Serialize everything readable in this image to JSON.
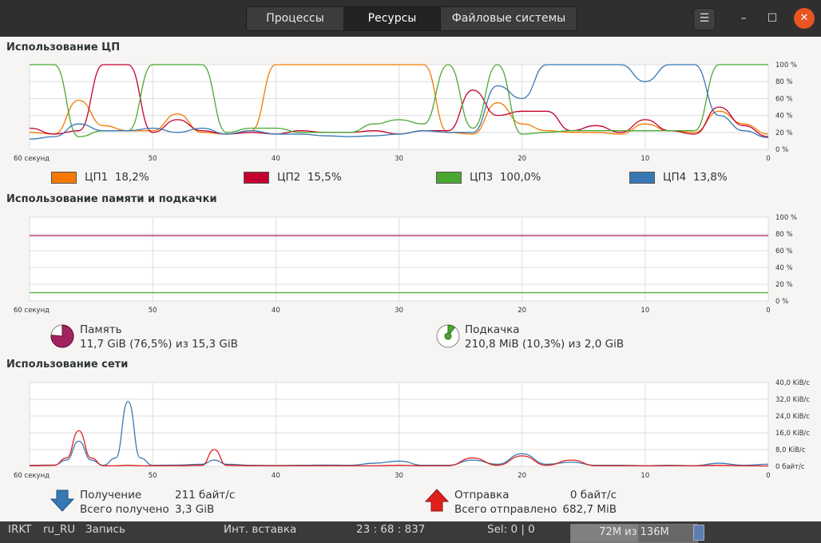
{
  "tabs": [
    {
      "label": "Процессы",
      "active": false
    },
    {
      "label": "Ресурсы",
      "active": true
    },
    {
      "label": "Файловые системы",
      "active": false
    }
  ],
  "window_buttons": {
    "menu_icon": "hamburger-menu-icon",
    "minimize_icon": "minimize-icon",
    "maximize_icon": "maximize-icon",
    "close_icon": "close-icon"
  },
  "sections": {
    "cpu_title": "Использование ЦП",
    "mem_title": "Использование памяти и подкачки",
    "net_title": "Использование сети"
  },
  "x_axis_labels": [
    "60 секунд",
    "50",
    "40",
    "30",
    "20",
    "10",
    "0"
  ],
  "cpu": {
    "legend": [
      {
        "label": "ЦП1",
        "value": "18,2%",
        "color": "#f57900"
      },
      {
        "label": "ЦП2",
        "value": "15,5%",
        "color": "#c4002f"
      },
      {
        "label": "ЦП3",
        "value": "100,0%",
        "color": "#4aa832"
      },
      {
        "label": "ЦП4",
        "value": "13,8%",
        "color": "#3778b4"
      }
    ]
  },
  "memory": {
    "label": "Память",
    "detail": "11,7 GiB (76,5%) из 15,3 GiB",
    "percent": 76.5,
    "color": "#a3225f",
    "swap_label": "Подкачка",
    "swap_detail": "210,8 MiB (10,3%) из 2,0 GiB",
    "swap_percent": 10.3,
    "swap_color": "#4aa832",
    "icon": "memory-pie-icon",
    "swap_icon": "swap-pie-icon"
  },
  "network": {
    "recv_label": "Получение",
    "recv_rate": "211 байт/с",
    "recv_total_label": "Всего получено",
    "recv_total": "3,3 GiB",
    "recv_color": "#3778b4",
    "recv_icon": "download-arrow-icon",
    "send_label": "Отправка",
    "send_rate": "0 байт/с",
    "send_total_label": "Всего отправлено",
    "send_total": "682,7 MiB",
    "send_color": "#e0201a",
    "send_icon": "upload-arrow-icon"
  },
  "status_bar": {
    "items": [
      "IRKT",
      "ru_RU",
      "Запись",
      "Инт. вставка",
      "23 : 68 : 837",
      "Sel: 0 | 0"
    ],
    "memory_text": "72M из 136M",
    "memory_fraction": 0.53,
    "trash_icon": "trash-icon"
  },
  "chart_data": [
    {
      "type": "line",
      "title": "Использование ЦП",
      "x": [
        60,
        58,
        56,
        54,
        52,
        50,
        48,
        46,
        44,
        42,
        40,
        38,
        36,
        34,
        32,
        30,
        28,
        26,
        24,
        22,
        20,
        18,
        16,
        14,
        12,
        10,
        8,
        6,
        4,
        2,
        0
      ],
      "xlabel_ticks": [
        "60 секунд",
        "50",
        "40",
        "30",
        "20",
        "10",
        "0"
      ],
      "ylim": [
        0,
        100
      ],
      "y_ticks": [
        "100 %",
        "80 %",
        "60 %",
        "40 %",
        "20 %",
        "0 %"
      ],
      "series": [
        {
          "name": "ЦП1",
          "values": [
            20,
            18,
            58,
            28,
            22,
            22,
            42,
            20,
            18,
            22,
            100,
            100,
            100,
            100,
            100,
            100,
            100,
            20,
            18,
            55,
            30,
            22,
            20,
            20,
            18,
            30,
            22,
            20,
            45,
            30,
            18
          ]
        },
        {
          "name": "ЦП2",
          "values": [
            25,
            18,
            22,
            100,
            100,
            20,
            35,
            22,
            18,
            20,
            18,
            22,
            20,
            20,
            22,
            18,
            22,
            22,
            70,
            40,
            45,
            45,
            22,
            28,
            20,
            35,
            22,
            18,
            50,
            28,
            15
          ]
        },
        {
          "name": "ЦП3",
          "values": [
            100,
            100,
            15,
            22,
            22,
            100,
            100,
            100,
            20,
            25,
            25,
            20,
            20,
            20,
            30,
            35,
            30,
            100,
            25,
            100,
            18,
            20,
            22,
            22,
            22,
            22,
            22,
            22,
            100,
            100,
            100
          ]
        },
        {
          "name": "ЦП4",
          "values": [
            12,
            15,
            30,
            22,
            22,
            25,
            20,
            25,
            18,
            22,
            18,
            18,
            16,
            15,
            16,
            18,
            22,
            20,
            20,
            75,
            60,
            100,
            100,
            100,
            100,
            80,
            100,
            100,
            40,
            22,
            14
          ]
        }
      ]
    },
    {
      "type": "line",
      "title": "Использование памяти и подкачки",
      "x": [
        60,
        50,
        40,
        30,
        20,
        10,
        0
      ],
      "ylim": [
        0,
        100
      ],
      "y_ticks": [
        "100 %",
        "80 %",
        "60 %",
        "40 %",
        "20 %",
        "0 %"
      ],
      "series": [
        {
          "name": "Память",
          "values": [
            78,
            78,
            78,
            78,
            78,
            78,
            78
          ]
        },
        {
          "name": "Подкачка",
          "values": [
            10,
            10,
            10,
            10,
            10,
            10,
            10
          ]
        }
      ]
    },
    {
      "type": "line",
      "title": "Использование сети",
      "x": [
        60,
        58,
        57,
        56,
        55,
        54,
        53,
        52,
        51,
        50,
        48,
        46,
        45,
        44,
        42,
        40,
        38,
        36,
        34,
        32,
        30,
        28,
        26,
        24,
        22,
        20,
        18,
        16,
        14,
        12,
        10,
        8,
        6,
        4,
        2,
        0
      ],
      "ylim": [
        0,
        40
      ],
      "y_ticks": [
        "40,0 KiB/c",
        "32,0 KiB/c",
        "24,0 KiB/c",
        "16,0 KiB/c",
        "8,0 KiB/c",
        "0 байт/с"
      ],
      "series": [
        {
          "name": "Получение",
          "values": [
            0.5,
            0.6,
            3,
            12,
            3,
            0.5,
            4,
            31,
            4,
            0.5,
            0.6,
            1,
            3,
            1,
            0.5,
            0.4,
            0.5,
            0.6,
            0.5,
            1.5,
            2.5,
            0.5,
            0.5,
            3,
            1,
            6,
            1,
            2,
            0.5,
            0.5,
            0.3,
            0.5,
            0.3,
            1.5,
            0.5,
            1
          ]
        },
        {
          "name": "Отправка",
          "values": [
            0.3,
            0.5,
            4,
            17,
            4,
            0.3,
            0.3,
            0.5,
            0.3,
            0.3,
            0.3,
            0.5,
            8,
            0.5,
            0.3,
            0.3,
            0.3,
            0.3,
            0.3,
            0.3,
            0.5,
            0.3,
            0.3,
            4,
            0.5,
            5,
            0.5,
            3,
            0.3,
            0.3,
            0.3,
            0.3,
            0.3,
            0.5,
            0.3,
            0.2
          ]
        }
      ]
    }
  ]
}
